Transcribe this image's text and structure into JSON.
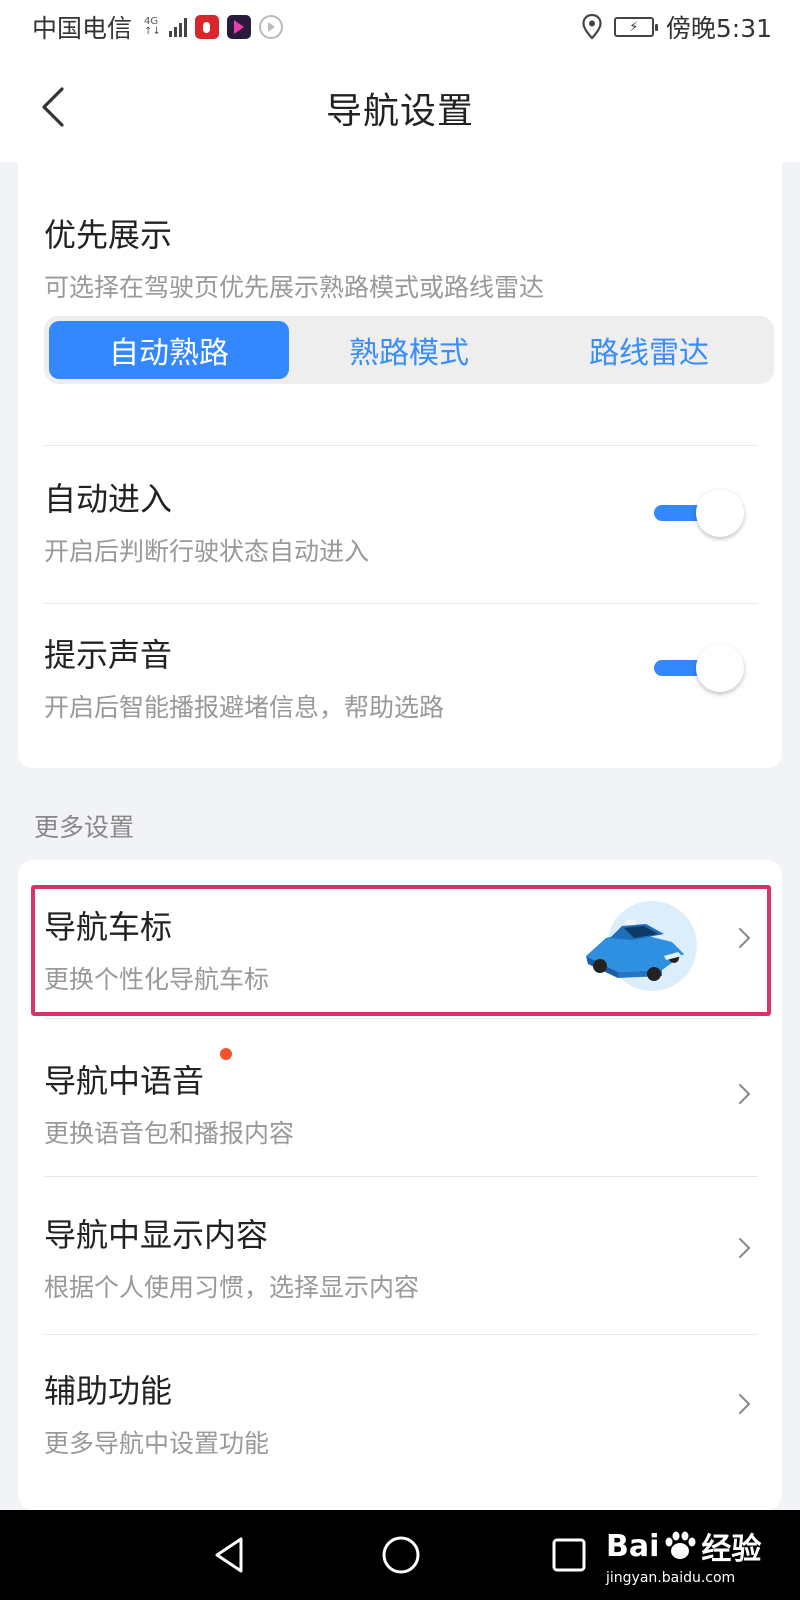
{
  "status_bar": {
    "carrier": "中国电信",
    "network": "4G",
    "time": "傍晚5:31"
  },
  "header": {
    "title": "导航设置",
    "back_icon": "chevron-left-icon"
  },
  "priority": {
    "title": "优先展示",
    "subtitle": "可选择在驾驶页优先展示熟路模式或路线雷达",
    "options": [
      "自动熟路",
      "熟路模式",
      "路线雷达"
    ],
    "selected_index": 0
  },
  "auto_enter": {
    "title": "自动进入",
    "subtitle": "开启后判断行驶状态自动进入",
    "enabled": true
  },
  "sound": {
    "title": "提示声音",
    "subtitle": "开启后智能播报避堵信息，帮助选路",
    "enabled": true
  },
  "more_section": {
    "label": "更多设置",
    "items": [
      {
        "title": "导航车标",
        "subtitle": "更换个性化导航车标",
        "icon": "car-icon",
        "highlighted": true
      },
      {
        "title": "导航中语音",
        "subtitle": "更换语音包和播报内容",
        "badge": "red-dot"
      },
      {
        "title": "导航中显示内容",
        "subtitle": "根据个人使用习惯，选择显示内容"
      },
      {
        "title": "辅助功能",
        "subtitle": "更多导航中设置功能"
      }
    ]
  },
  "navbar": {
    "buttons": [
      "back-triangle-icon",
      "home-circle-icon",
      "recents-square-icon"
    ]
  },
  "watermark": {
    "brand_latin": "Bai",
    "brand_cn": "经验",
    "url": "jingyan.baidu.com"
  },
  "colors": {
    "accent": "#3388ff",
    "highlight_border": "#d6336c",
    "badge_dot": "#f4522c",
    "page_bg": "#f2f3f7"
  }
}
